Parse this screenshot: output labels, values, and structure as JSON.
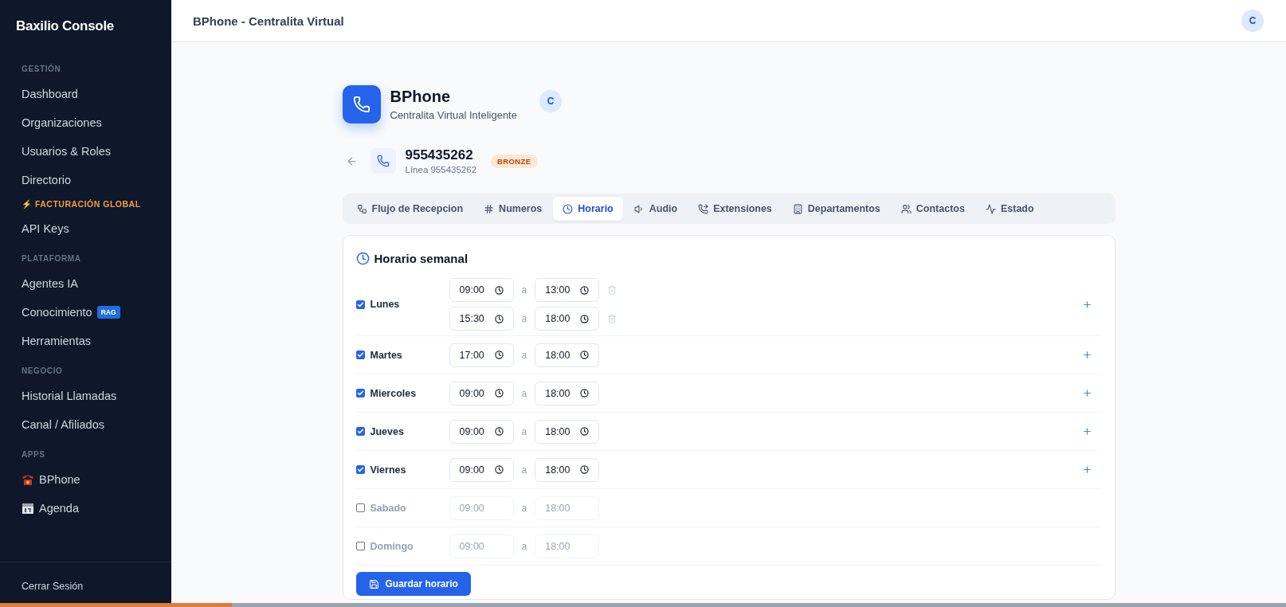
{
  "sidebar": {
    "brand": "Baxilio Console",
    "sections": [
      {
        "title": "GESTIÓN",
        "items": [
          {
            "kind": "link",
            "label": "Dashboard"
          },
          {
            "kind": "link",
            "label": "Organizaciones"
          },
          {
            "kind": "link",
            "label": "Usuarios & Roles"
          },
          {
            "kind": "link",
            "label": "Directorio"
          },
          {
            "kind": "alert",
            "label": "⚡ FACTURACIÓN GLOBAL"
          },
          {
            "kind": "link",
            "label": "API Keys"
          }
        ]
      },
      {
        "title": "PLATAFORMA",
        "items": [
          {
            "kind": "link",
            "label": "Agentes IA"
          },
          {
            "kind": "link",
            "label": "Conocimiento",
            "badge": "RAG"
          },
          {
            "kind": "link",
            "label": "Herramientas"
          }
        ]
      },
      {
        "title": "NEGOCIO",
        "items": [
          {
            "kind": "link",
            "label": "Historial Llamadas"
          },
          {
            "kind": "link",
            "label": "Canal / Afiliados"
          }
        ]
      },
      {
        "title": "APPS",
        "items": [
          {
            "kind": "phone-app",
            "label": "BPhone"
          },
          {
            "kind": "calendar-app",
            "label": "Agenda"
          }
        ]
      }
    ],
    "footer": "Cerrar Sesión"
  },
  "header": {
    "title": "BPhone - Centralita Virtual",
    "avatar": "C"
  },
  "app": {
    "title": "BPhone",
    "subtitle": "Centralita Virtual Inteligente",
    "avatar": "C"
  },
  "line": {
    "number": "955435262",
    "subtitle": "Línea 955435262",
    "tier": "BRONZE"
  },
  "tabs": [
    {
      "label": "Flujo de Recepcion",
      "selected": false
    },
    {
      "label": "Numeros",
      "selected": false
    },
    {
      "label": "Horario",
      "selected": true
    },
    {
      "label": "Audio",
      "selected": false
    },
    {
      "label": "Extensiones",
      "selected": false
    },
    {
      "label": "Departamentos",
      "selected": false
    },
    {
      "label": "Contactos",
      "selected": false
    },
    {
      "label": "Estado",
      "selected": false
    }
  ],
  "schedule": {
    "title": "Horario semanal",
    "days": [
      {
        "name": "Lunes",
        "enabled": true,
        "slots": [
          {
            "from": "09:00",
            "sep": "a",
            "to": "13:00"
          },
          {
            "from": "15:30",
            "sep": "a",
            "to": "18:00"
          }
        ]
      },
      {
        "name": "Martes",
        "enabled": true,
        "slots": [
          {
            "from": "17:00",
            "sep": "a",
            "to": "18:00"
          }
        ]
      },
      {
        "name": "Miercoles",
        "enabled": true,
        "slots": [
          {
            "from": "09:00",
            "sep": "a",
            "to": "18:00"
          }
        ]
      },
      {
        "name": "Jueves",
        "enabled": true,
        "slots": [
          {
            "from": "09:00",
            "sep": "a",
            "to": "18:00"
          }
        ]
      },
      {
        "name": "Viernes",
        "enabled": true,
        "slots": [
          {
            "from": "09:00",
            "sep": "a",
            "to": "18:00"
          }
        ]
      },
      {
        "name": "Sabado",
        "enabled": false,
        "slots": [
          {
            "from": "09:00",
            "sep": "a",
            "to": "18:00"
          }
        ]
      },
      {
        "name": "Domingo",
        "enabled": false,
        "slots": [
          {
            "from": "09:00",
            "sep": "a",
            "to": "18:00"
          }
        ]
      }
    ],
    "save": "Guardar horario"
  },
  "loading_bar": {
    "level": 0.18
  }
}
